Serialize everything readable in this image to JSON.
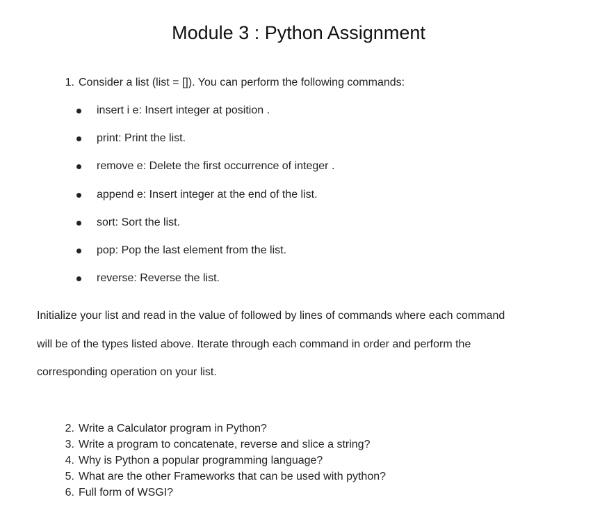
{
  "document": {
    "title": "Module 3 : Python Assignment",
    "question1": {
      "number": "1.",
      "text": "Consider a list (list = []). You can perform the following commands:",
      "commands": [
        "insert i e: Insert integer  at position .",
        "print: Print the list.",
        "remove e: Delete the first occurrence of integer .",
        "append e: Insert integer  at the end of the list.",
        "sort: Sort the list.",
        "pop: Pop the last element from the list.",
        "reverse: Reverse the list."
      ],
      "paragraph_lines": [
        "Initialize your list and read in the value of  followed by  lines of commands where each command",
        "will be of the  types listed above. Iterate through each command in order and perform the",
        "corresponding operation on your list."
      ]
    },
    "questions": [
      {
        "number": "2.",
        "text": "Write a Calculator program in Python?"
      },
      {
        "number": "3.",
        "text": "Write a program to concatenate, reverse and slice a string?"
      },
      {
        "number": "4.",
        "text": "Why is Python a popular programming language?"
      },
      {
        "number": "5.",
        "text": "What are the other Frameworks that can be used with python?"
      },
      {
        "number": "6.",
        "text": "Full form of WSGI?"
      }
    ]
  }
}
